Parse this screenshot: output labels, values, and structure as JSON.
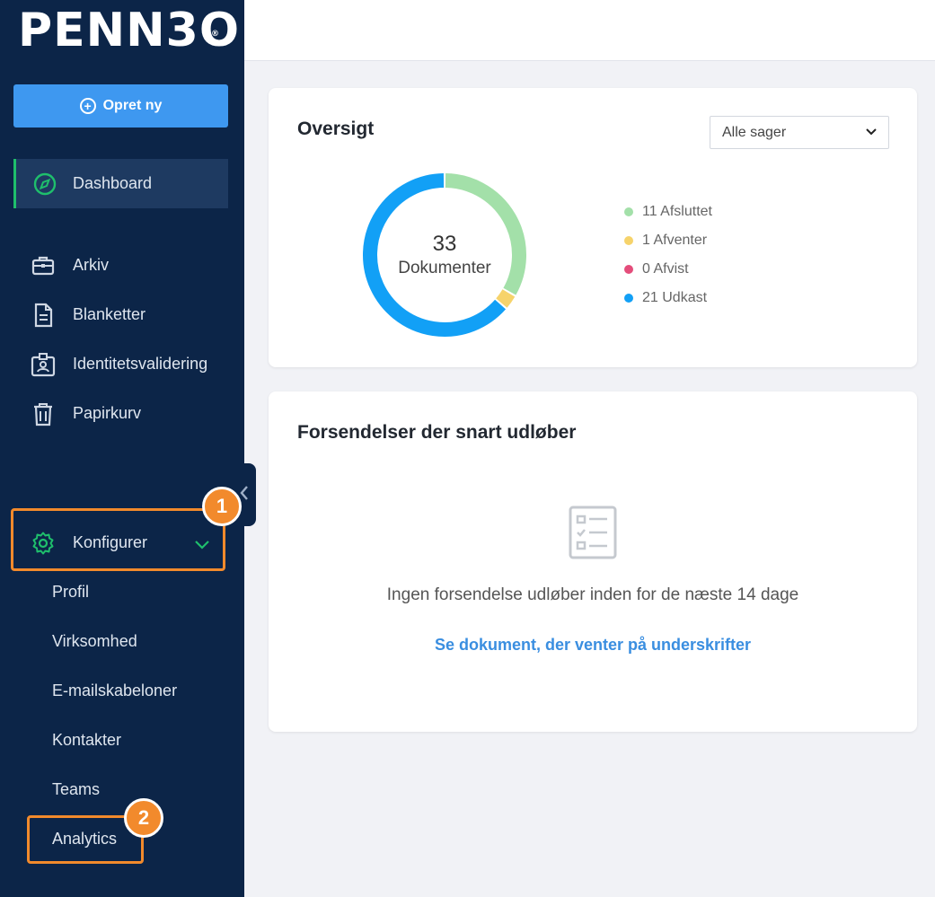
{
  "brand": {
    "logo_text": "PENN3O",
    "trademark": "®"
  },
  "sidebar": {
    "create_label": "Opret ny",
    "items": [
      {
        "label": "Dashboard",
        "icon": "compass-icon"
      },
      {
        "label": "Arkiv",
        "icon": "briefcase-icon"
      },
      {
        "label": "Blanketter",
        "icon": "document-icon"
      },
      {
        "label": "Identitetsvalidering",
        "icon": "id-badge-icon"
      },
      {
        "label": "Papirkurv",
        "icon": "trash-icon"
      }
    ],
    "configure": {
      "label": "Konfigurer",
      "icon": "gear-icon"
    },
    "sub_items": [
      "Profil",
      "Virksomhed",
      "E-mailskabeloner",
      "Kontakter",
      "Teams",
      "Analytics"
    ],
    "collapse_icon": "chevron-left-icon"
  },
  "annotations": {
    "step1": "1",
    "step2": "2",
    "color": "#f28a2c"
  },
  "overview": {
    "title": "Oversigt",
    "filter_value": "Alle sager",
    "total": "33",
    "total_label": "Dokumenter",
    "legend": [
      {
        "label": "11 Afsluttet",
        "count": 11,
        "color": "#a3e0a9"
      },
      {
        "label": "1 Afventer",
        "count": 1,
        "color": "#f6d36b"
      },
      {
        "label": "0 Afvist",
        "count": 0,
        "color": "#e44d7b"
      },
      {
        "label": "21 Udkast",
        "count": 21,
        "color": "#12a0f6"
      }
    ]
  },
  "expiring": {
    "title": "Forsendelser der snart udløber",
    "empty_text": "Ingen forsendelse udløber inden for de næste 14 dage",
    "link": "Se dokument, der venter på underskrifter",
    "icon": "checklist-icon"
  }
}
